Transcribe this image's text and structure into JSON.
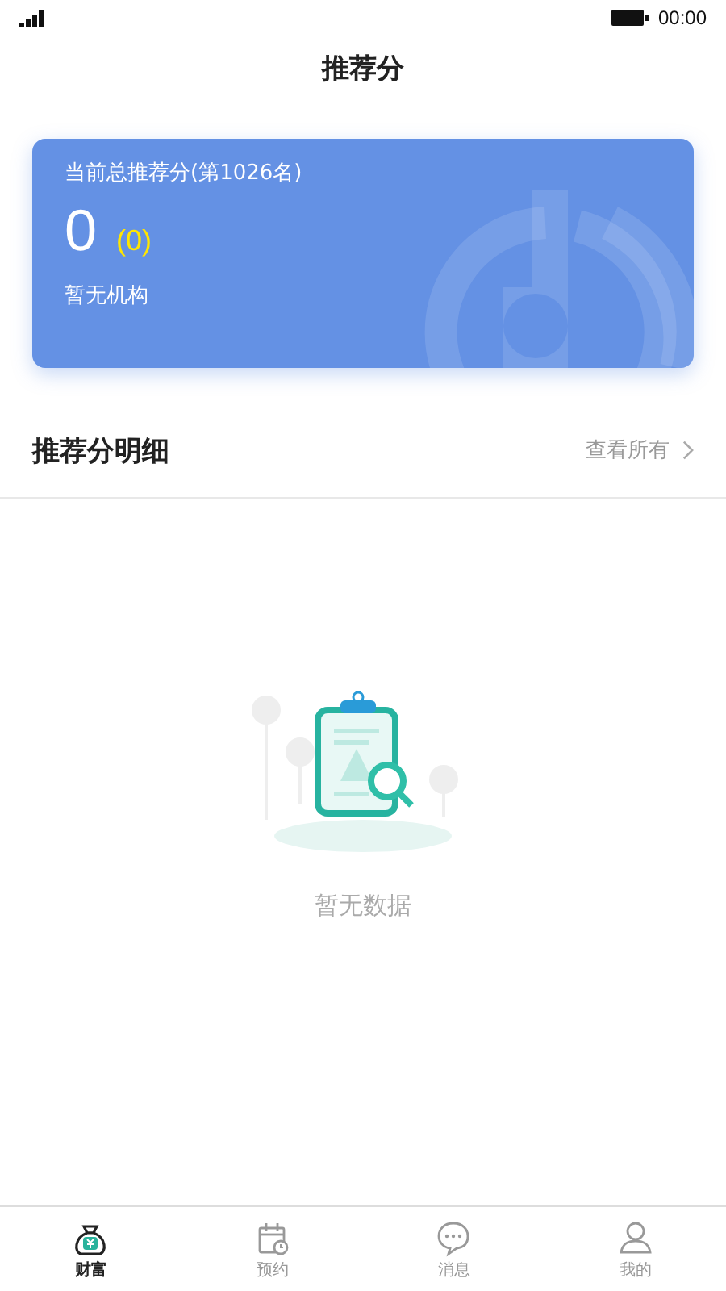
{
  "status_bar": {
    "time": "00:00"
  },
  "nav_bar": {
    "title": "推荐分"
  },
  "score_card": {
    "heading": "当前总推荐分(第1026名)",
    "score": "0",
    "change": "(0)",
    "institution": "暂无机构"
  },
  "detail_section": {
    "title": "推荐分明细",
    "link": "查看所有"
  },
  "empty_state": {
    "message": "暂无数据"
  },
  "tabs": [
    {
      "label": "财富",
      "kind": "wealth",
      "selected": true
    },
    {
      "label": "预约",
      "kind": "calendar",
      "selected": false
    },
    {
      "label": "消息",
      "kind": "message",
      "selected": false
    },
    {
      "label": "我的",
      "kind": "profile",
      "selected": false
    }
  ]
}
